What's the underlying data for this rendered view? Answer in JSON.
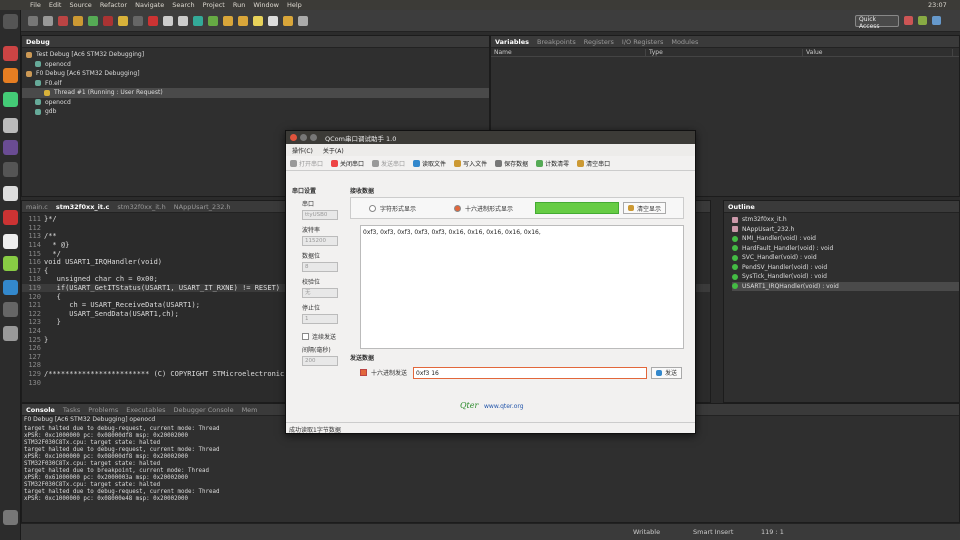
{
  "menubar": {
    "items": [
      "File",
      "Edit",
      "Source",
      "Refactor",
      "Navigate",
      "Search",
      "Project",
      "Run",
      "Window",
      "Help"
    ],
    "clock": "23:07"
  },
  "toolbar": {
    "quick_access": "Quick Access"
  },
  "debug_view": {
    "tab": "Debug",
    "items": [
      {
        "label": "Test Debug [Ac6 STM32 Debugging]",
        "indent": 0
      },
      {
        "label": "openocd",
        "indent": 1
      },
      {
        "label": "F0 Debug [Ac6 STM32 Debugging]",
        "indent": 0
      },
      {
        "label": "F0.elf",
        "indent": 1
      },
      {
        "label": "Thread #1 (Running : User Request)",
        "indent": 2
      },
      {
        "label": "openocd",
        "indent": 1
      },
      {
        "label": "gdb",
        "indent": 1
      }
    ]
  },
  "variables_view": {
    "tabs": [
      "Variables",
      "Breakpoints",
      "Registers",
      "I/O Registers",
      "Modules"
    ],
    "columns": [
      "Name",
      "Type",
      "Value"
    ]
  },
  "editor": {
    "tabs": [
      "main.c",
      "stm32f0xx_it.c",
      "stm32f0xx_it.h",
      "NAppUsart_232.h"
    ],
    "lines": [
      {
        "n": "111",
        "text": "}*/"
      },
      {
        "n": "112",
        "text": ""
      },
      {
        "n": "113",
        "text": "/**"
      },
      {
        "n": "114",
        "text": "  * @}"
      },
      {
        "n": "115",
        "text": "  */"
      },
      {
        "n": "116",
        "text": "void USART1_IRQHandler(void)"
      },
      {
        "n": "117",
        "text": "{"
      },
      {
        "n": "118",
        "text": "   unsigned char ch = 0x00;"
      },
      {
        "n": "119",
        "text": "   if(USART_GetITStatus(USART1, USART_IT_RXNE) != RESET)"
      },
      {
        "n": "120",
        "text": "   {"
      },
      {
        "n": "121",
        "text": "      ch = USART_ReceiveData(USART1);"
      },
      {
        "n": "122",
        "text": "      USART_SendData(USART1,ch);"
      },
      {
        "n": "123",
        "text": "   }"
      },
      {
        "n": "124",
        "text": ""
      },
      {
        "n": "125",
        "text": "}"
      },
      {
        "n": "126",
        "text": ""
      },
      {
        "n": "127",
        "text": ""
      },
      {
        "n": "128",
        "text": ""
      },
      {
        "n": "129",
        "text": "/************************ (C) COPYRIGHT STMicroelectronics *****END OF FILE****/"
      },
      {
        "n": "130",
        "text": ""
      }
    ]
  },
  "outline": {
    "tab": "Outline",
    "items": [
      "stm32f0xx_it.h",
      "NAppUsart_232.h",
      "NMI_Handler(void) : void",
      "HardFault_Handler(void) : void",
      "SVC_Handler(void) : void",
      "PendSV_Handler(void) : void",
      "SysTick_Handler(void) : void",
      "USART1_IRQHandler(void) : void"
    ]
  },
  "console": {
    "tabs": [
      "Console",
      "Tasks",
      "Problems",
      "Executables",
      "Debugger Console",
      "Mem"
    ],
    "subtitle": "F0 Debug [Ac6 STM32 Debugging] openocd",
    "lines": [
      "target halted due to debug-request, current mode: Thread",
      "xPSR: 0xc1000000 pc: 0x08000df8 msp: 0x20002000",
      "STM32F030C8Tx.cpu: target state: halted",
      "target halted due to debug-request, current mode: Thread",
      "xPSR: 0xc1000000 pc: 0x08000df8 msp: 0x20002000",
      "STM32F030C8Tx.cpu: target state: halted",
      "target halted due to breakpoint, current mode: Thread",
      "xPSR: 0x61000000 pc: 0x2000003a msp: 0x20002000",
      "STM32F030C8Tx.cpu: target state: halted",
      "target halted due to debug-request, current mode: Thread",
      "xPSR: 0xc1000000 pc: 0x08000e48 msp: 0x20002000"
    ]
  },
  "qcom": {
    "title": "QCom串口调试助手 1.0",
    "menu": [
      "操作(C)",
      "关于(A)"
    ],
    "toolbar": [
      "打开串口",
      "关闭串口",
      "发送串口",
      "读取文件",
      "写入文件",
      "保存数据",
      "计数清零",
      "清空串口"
    ],
    "port_settings": {
      "title": "串口设置",
      "port_label": "串口",
      "port_value": "ttyUSB0",
      "baud_label": "波特率",
      "baud_value": "115200",
      "data_label": "数据位",
      "data_value": "8",
      "parity_label": "校验位",
      "parity_value": "无",
      "stop_label": "停止位",
      "stop_value": "1",
      "continuous_label": "连续发送",
      "interval_label": "间隔(毫秒)",
      "interval_value": "200"
    },
    "receive": {
      "title": "接收数据",
      "char_mode": "字符形式显示",
      "hex_mode": "十六进制形式显示",
      "clear_btn": "清空显示",
      "text": "0xf3, 0xf3, 0xf3, 0xf3, 0xf3, 0x16, 0x16, 0x16, 0x16, 0x16,"
    },
    "send": {
      "title": "发送数据",
      "hex_label": "十六进制发送",
      "input_value": "0xf3 16",
      "send_btn": "发送"
    },
    "logo": "Qter",
    "url": "www.qter.org",
    "status": "成功读取1字节数据"
  },
  "statusbar": {
    "writable": "Writable",
    "insert": "Smart Insert",
    "position": "119 : 1"
  }
}
